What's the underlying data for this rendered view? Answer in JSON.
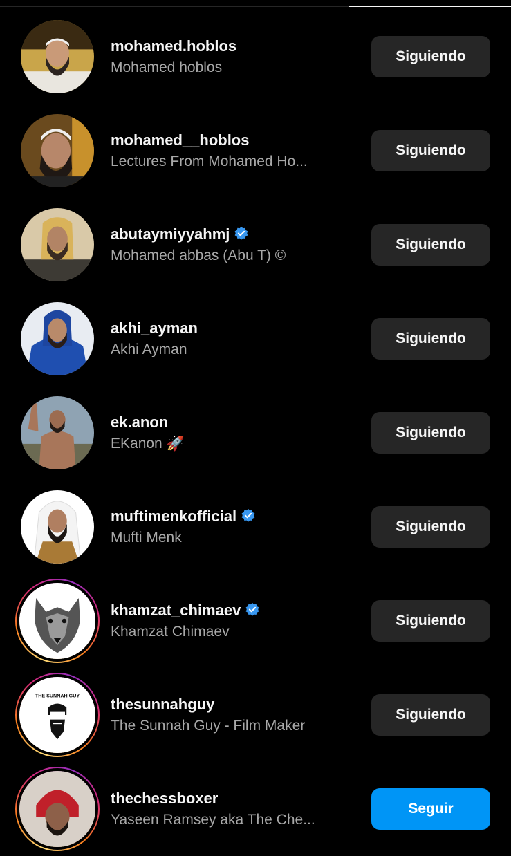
{
  "accounts": [
    {
      "username": "mohamed.hoblos",
      "full_name": "Mohamed hoblos",
      "verified": false,
      "story_ring": false,
      "button": "Siguiendo",
      "following": true
    },
    {
      "username": "mohamed__hoblos",
      "full_name": "Lectures From Mohamed Ho...",
      "verified": false,
      "story_ring": false,
      "button": "Siguiendo",
      "following": true
    },
    {
      "username": "abutaymiyyahmj",
      "full_name": "Mohamed abbas (Abu T) ©",
      "verified": true,
      "story_ring": false,
      "button": "Siguiendo",
      "following": true
    },
    {
      "username": "akhi_ayman",
      "full_name": "Akhi Ayman",
      "verified": false,
      "story_ring": false,
      "button": "Siguiendo",
      "following": true
    },
    {
      "username": "ek.anon",
      "full_name": "EKanon 🚀",
      "verified": false,
      "story_ring": false,
      "button": "Siguiendo",
      "following": true
    },
    {
      "username": "muftimenkofficial",
      "full_name": "Mufti Menk",
      "verified": true,
      "story_ring": false,
      "button": "Siguiendo",
      "following": true
    },
    {
      "username": "khamzat_chimaev",
      "full_name": "Khamzat Chimaev",
      "verified": true,
      "story_ring": true,
      "button": "Siguiendo",
      "following": true
    },
    {
      "username": "thesunnahguy",
      "full_name": "The Sunnah Guy - Film Maker",
      "verified": false,
      "story_ring": true,
      "button": "Siguiendo",
      "following": true,
      "avatar_text": "THE SUNNAH GUY"
    },
    {
      "username": "thechessboxer",
      "full_name": "Yaseen Ramsey aka The Che...",
      "verified": false,
      "story_ring": true,
      "button": "Seguir",
      "following": false
    }
  ],
  "colors": {
    "background": "#000000",
    "following_button": "#262626",
    "follow_button": "#0095f6",
    "verified_badge": "#3897f0",
    "secondary_text": "#a8a8a8"
  }
}
